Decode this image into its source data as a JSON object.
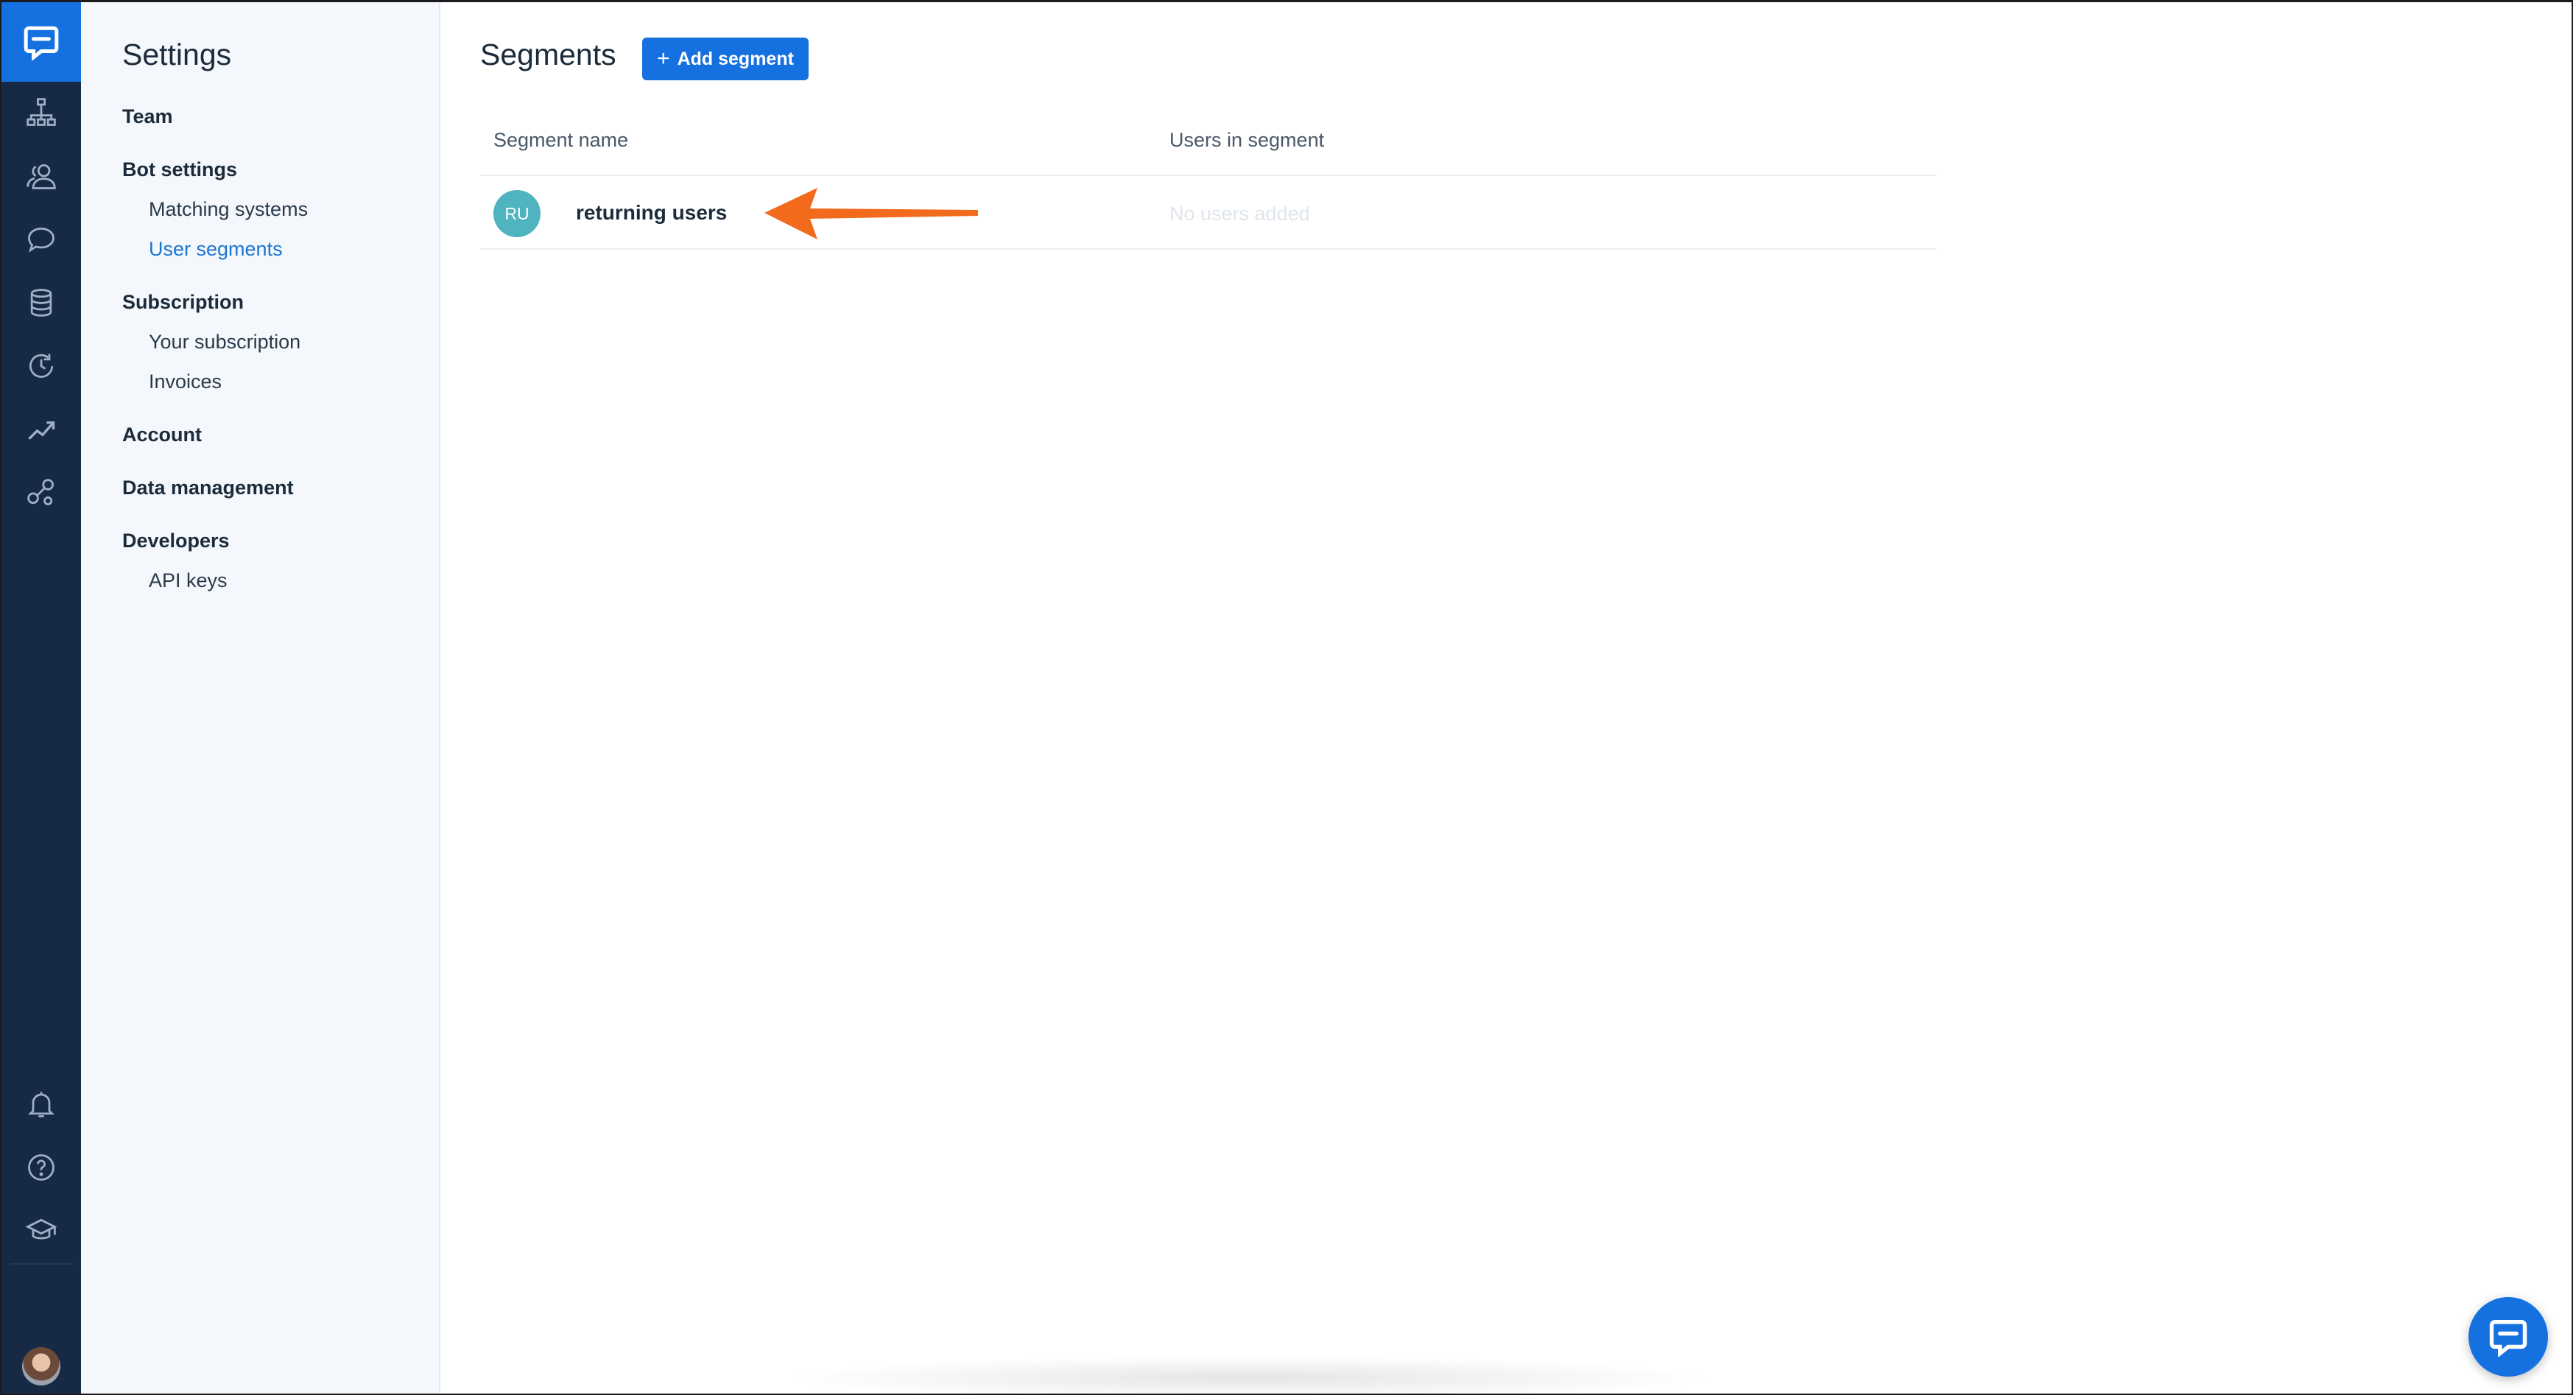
{
  "sidebar": {
    "title": "Settings",
    "sections": [
      {
        "label": "Team"
      },
      {
        "label": "Bot settings",
        "items": [
          "Matching systems",
          "User segments"
        ]
      },
      {
        "label": "Subscription",
        "items": [
          "Your subscription",
          "Invoices"
        ]
      },
      {
        "label": "Account"
      },
      {
        "label": "Data management"
      },
      {
        "label": "Developers",
        "items": [
          "API keys"
        ]
      }
    ],
    "active_item": "User segments"
  },
  "rail": {
    "icons": [
      "chat-logo-icon",
      "org-chart-icon",
      "users-icon",
      "chat-bubble-icon",
      "database-icon",
      "history-icon",
      "trend-icon",
      "integrations-icon",
      "bell-icon",
      "help-icon",
      "graduation-cap-icon"
    ]
  },
  "main": {
    "title": "Segments",
    "add_button": "Add segment",
    "columns": [
      "Segment name",
      "Users in segment"
    ],
    "rows": [
      {
        "initials": "RU",
        "name": "returning users",
        "users": "No users added"
      }
    ]
  },
  "colors": {
    "accent": "#1671e0",
    "rail": "#172a45",
    "active_link": "#1976d2",
    "avatar": "#4fb3c0",
    "annotation_arrow": "#f26a1b"
  }
}
